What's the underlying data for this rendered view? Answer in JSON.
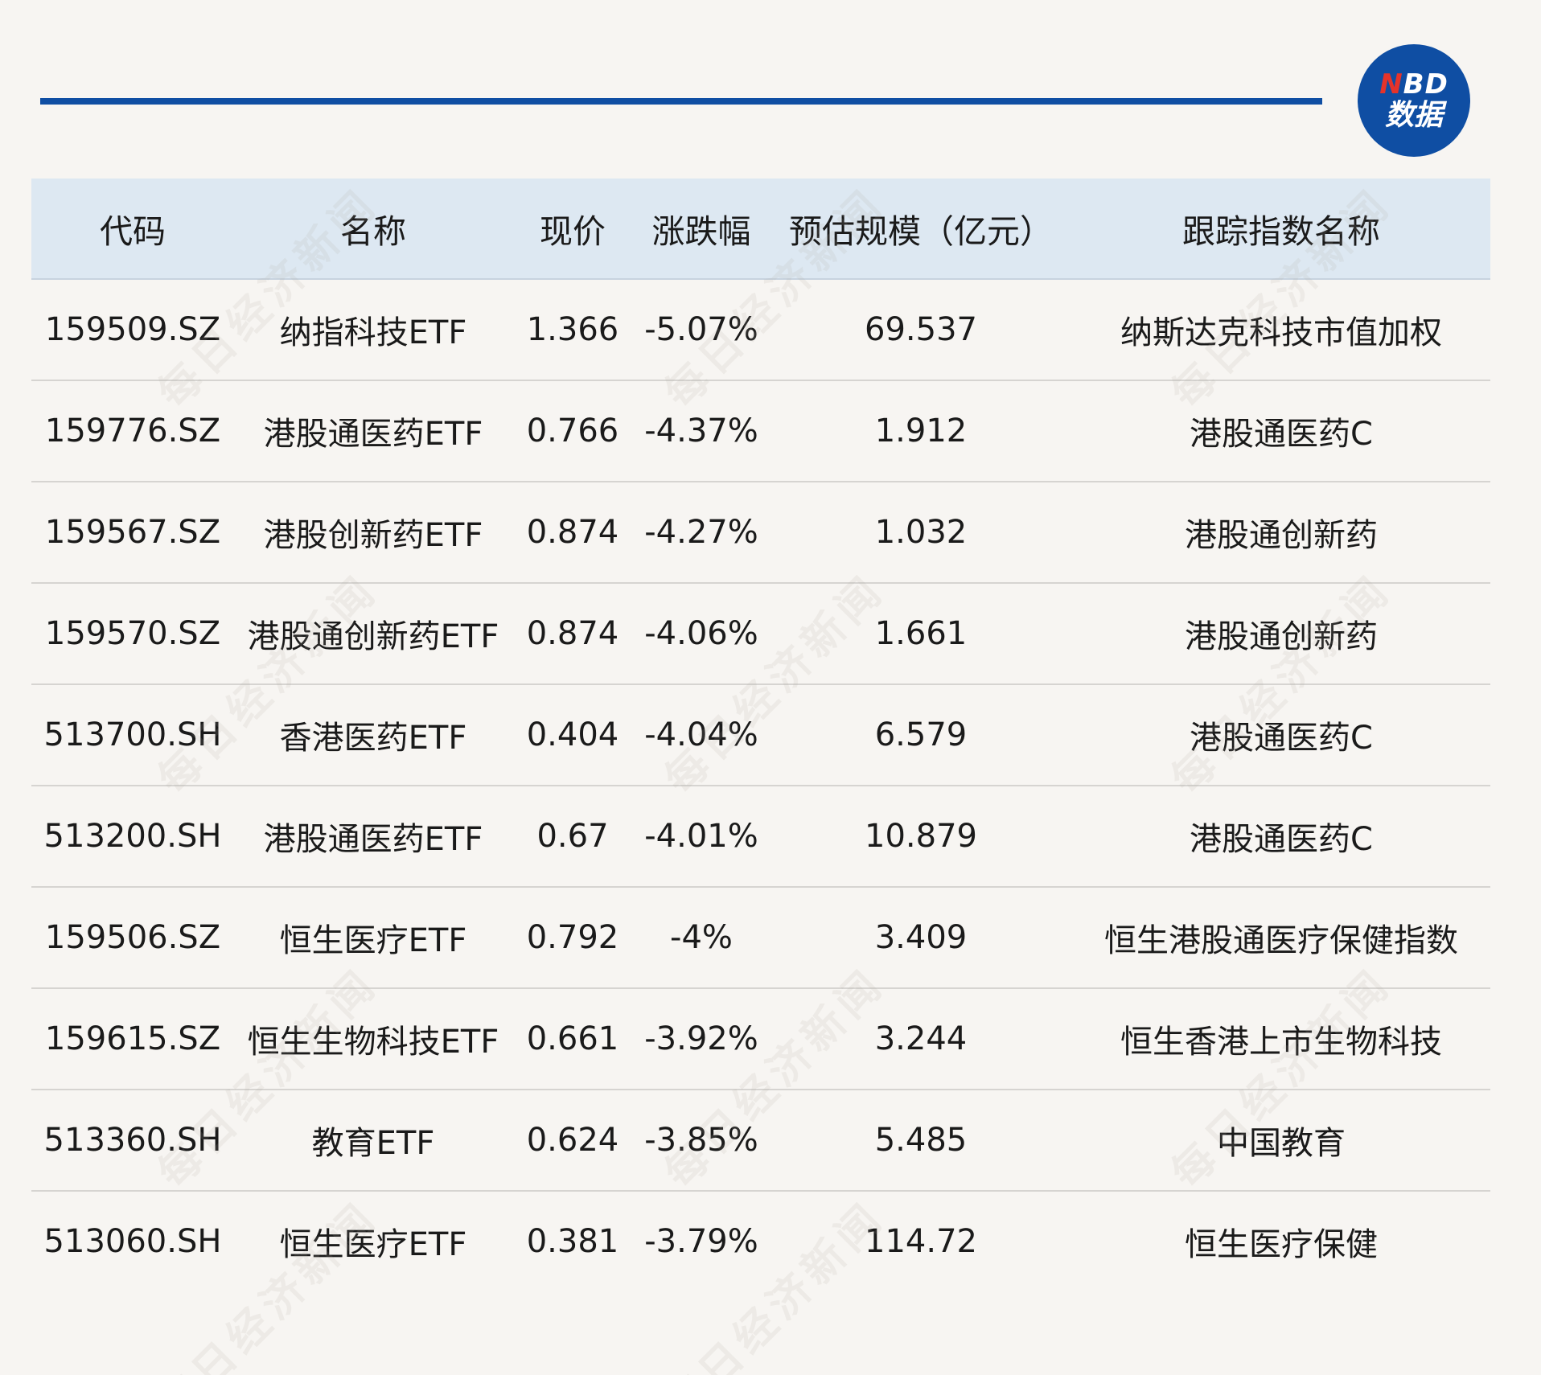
{
  "brand": {
    "logo_line1_n": "N",
    "logo_line1_rest": "BD",
    "logo_line2": "数据",
    "accent": "#0f4ea3",
    "logo_n_color": "#e5332a"
  },
  "watermark_text": "每日经济新闻",
  "table": {
    "headers": [
      "代码",
      "名称",
      "现价",
      "涨跌幅",
      "预估规模（亿元）",
      "跟踪指数名称"
    ],
    "rows": [
      [
        "159509.SZ",
        "纳指科技ETF",
        "1.366",
        "-5.07%",
        "69.537",
        "纳斯达克科技市值加权"
      ],
      [
        "159776.SZ",
        "港股通医药ETF",
        "0.766",
        "-4.37%",
        "1.912",
        "港股通医药C"
      ],
      [
        "159567.SZ",
        "港股创新药ETF",
        "0.874",
        "-4.27%",
        "1.032",
        "港股通创新药"
      ],
      [
        "159570.SZ",
        "港股通创新药ETF",
        "0.874",
        "-4.06%",
        "1.661",
        "港股通创新药"
      ],
      [
        "513700.SH",
        "香港医药ETF",
        "0.404",
        "-4.04%",
        "6.579",
        "港股通医药C"
      ],
      [
        "513200.SH",
        "港股通医药ETF",
        "0.67",
        "-4.01%",
        "10.879",
        "港股通医药C"
      ],
      [
        "159506.SZ",
        "恒生医疗ETF",
        "0.792",
        "-4%",
        "3.409",
        "恒生港股通医疗保健指数"
      ],
      [
        "159615.SZ",
        "恒生生物科技ETF",
        "0.661",
        "-3.92%",
        "3.244",
        "恒生香港上市生物科技"
      ],
      [
        "513360.SH",
        "教育ETF",
        "0.624",
        "-3.85%",
        "5.485",
        "中国教育"
      ],
      [
        "513060.SH",
        "恒生医疗ETF",
        "0.381",
        "-3.79%",
        "114.72",
        "恒生医疗保健"
      ]
    ]
  }
}
